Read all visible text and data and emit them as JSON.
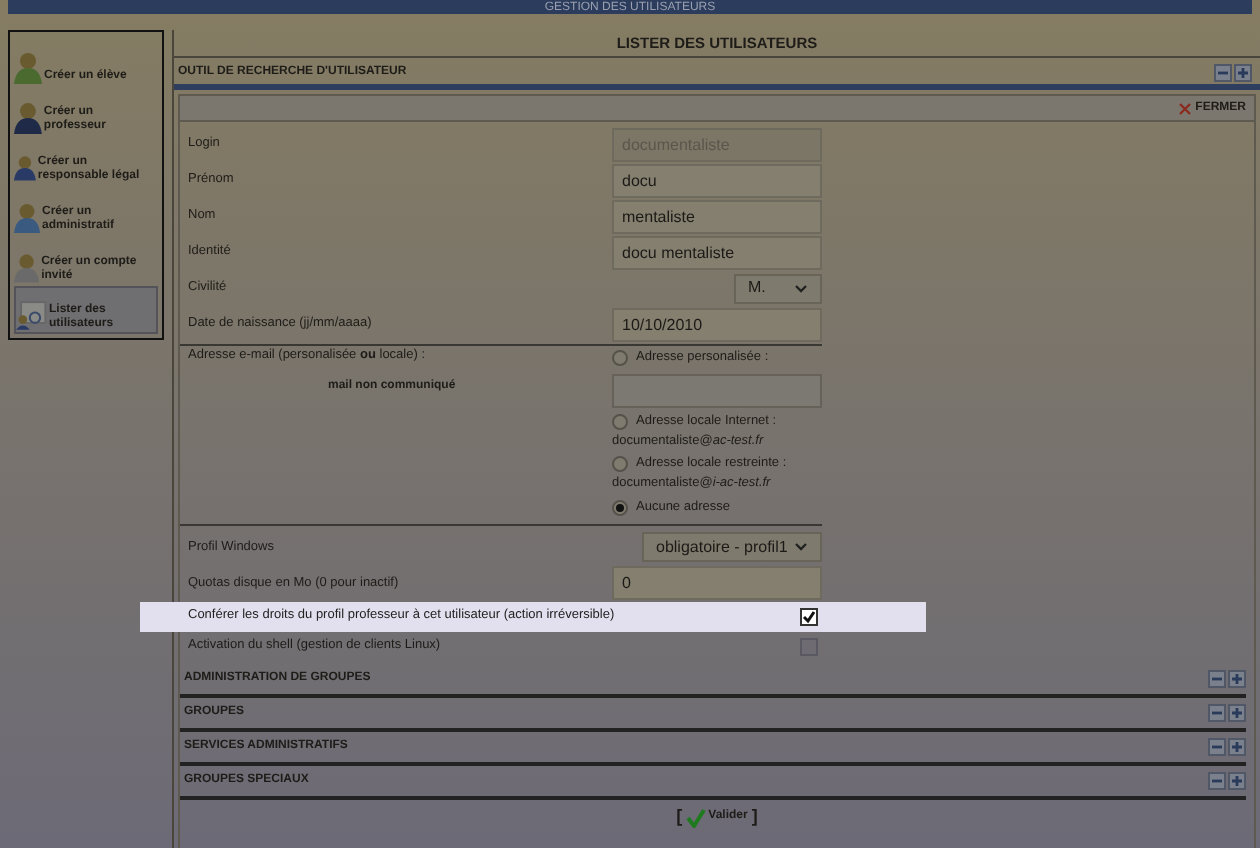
{
  "header": {
    "title": "GESTION DES UTILISATEURS"
  },
  "sidebar": {
    "items": [
      {
        "label": "Créer un élève",
        "kind": "student",
        "selected": false
      },
      {
        "label": "Créer un professeur",
        "kind": "teacher",
        "selected": false
      },
      {
        "label": "Créer un responsable légal",
        "kind": "guardian",
        "selected": false
      },
      {
        "label": "Créer un administratif",
        "kind": "admin",
        "selected": false
      },
      {
        "label": "Créer un compte invité",
        "kind": "guest",
        "selected": false
      },
      {
        "label": "Lister des utilisateurs",
        "kind": "list",
        "selected": true
      }
    ]
  },
  "page_title": "LISTER DES UTILISATEURS",
  "panel": {
    "title": "OUTIL DE RECHERCHE D'UTILISATEUR",
    "close": "FERMER"
  },
  "fields": [
    {
      "kind": "input",
      "label": "Login",
      "value": "documentaliste",
      "disabled": true
    },
    {
      "kind": "input",
      "label": "Prénom",
      "value": "docu",
      "disabled": false
    },
    {
      "kind": "input",
      "label": "Nom",
      "value": "mentaliste",
      "disabled": false
    },
    {
      "kind": "input",
      "label": "Identité",
      "value": "docu mentaliste",
      "disabled": false
    },
    {
      "kind": "select",
      "label": "Civilité",
      "value": "M."
    },
    {
      "kind": "input",
      "label": "Date de naissance (jj/mm/aaaa)",
      "value": "10/10/2010",
      "disabled": false
    }
  ],
  "email": {
    "label": "Adresse e-mail (personalisée **ou** locale) :",
    "note": "mail non communiqué",
    "options": [
      {
        "label": "Adresse personalisée :",
        "kind": "field",
        "selected": false
      },
      {
        "label": "Adresse locale Internet :",
        "kind": "address",
        "address": "documentaliste@*ac-test.fr*",
        "selected": false
      },
      {
        "label": "Adresse locale restreinte :",
        "kind": "address",
        "address": "documentaliste@*i-ac-test.fr*",
        "selected": false
      },
      {
        "label": "Aucune adresse",
        "kind": "plain",
        "selected": true
      }
    ]
  },
  "fields2": [
    {
      "kind": "wideselect",
      "label": "Profil Windows",
      "value": "obligatoire - profil1"
    },
    {
      "kind": "input",
      "label": "Quotas disque en Mo (0 pour inactif)",
      "value": "0",
      "disabled": false
    },
    {
      "kind": "checkbox",
      "label": "Conférer les droits du profil professeur à cet utilisateur (action irréversible)",
      "checked": true,
      "highlighted": true
    },
    {
      "kind": "checkbox",
      "label": "Activation du shell (gestion de clients Linux)",
      "checked": false,
      "highlighted": false
    }
  ],
  "sections": [
    "ADMINISTRATION DE GROUPES",
    "GROUPES",
    "SERVICES ADMINISTRATIFS",
    "GROUPES SPECIAUX"
  ],
  "submit": {
    "open": "[",
    "label": "Valider",
    "close": "]"
  }
}
